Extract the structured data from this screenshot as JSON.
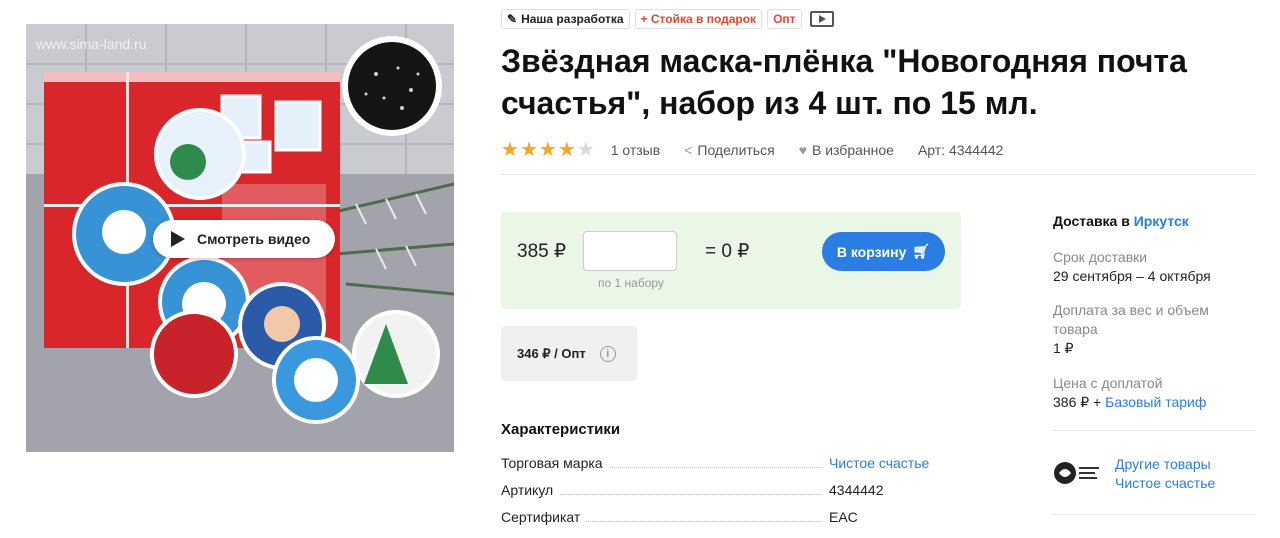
{
  "gallery": {
    "watermark": "www.sima-land.ru",
    "video_button": "Смотреть видео"
  },
  "tags": {
    "developer": "Наша разработка",
    "gift": "+ Стойка в подарок",
    "wholesale": "Опт"
  },
  "product": {
    "title": "Звёздная маска-плёнка \"Новогодняя почта счастья\", набор из 4 шт. по 15 мл.",
    "rating": 4,
    "rating_max": 5,
    "reviews": "1 отзыв",
    "share": "Поделиться",
    "favorite": "В избранное",
    "article": "Арт: 4344442"
  },
  "purchase": {
    "price": "385 ₽",
    "quantity_value": "",
    "quantity_hint": "по 1 набору",
    "total": "= 0 ₽",
    "cart_button": "В корзину",
    "wholesale_price": "346 ₽ / Опт"
  },
  "characteristics": {
    "title": "Характеристики",
    "rows": [
      {
        "key": "Торговая марка",
        "value": "Чистое счастье"
      },
      {
        "key": "Артикул",
        "value": "4344442"
      },
      {
        "key": "Сертификат",
        "value": "EAC"
      }
    ]
  },
  "delivery": {
    "title_prefix": "Доставка в",
    "city": "Иркутск",
    "term_label": "Срок доставки",
    "term_value": "29 сентября – 4 октября",
    "surcharge_label": "Доплата за вес и объем товара",
    "surcharge_value": "1 ₽",
    "price_label": "Цена с доплатой",
    "price_value": "386 ₽ +",
    "tariff_link": "Базовый тариф"
  },
  "brand": {
    "other_goods": "Другие товары",
    "brand_name": "Чистое счастье"
  },
  "colors": {
    "accent": "#2a7de1",
    "star": "#f5a623",
    "tag_red": "#e8452f",
    "pricebox_bg": "#eaf6e6"
  }
}
